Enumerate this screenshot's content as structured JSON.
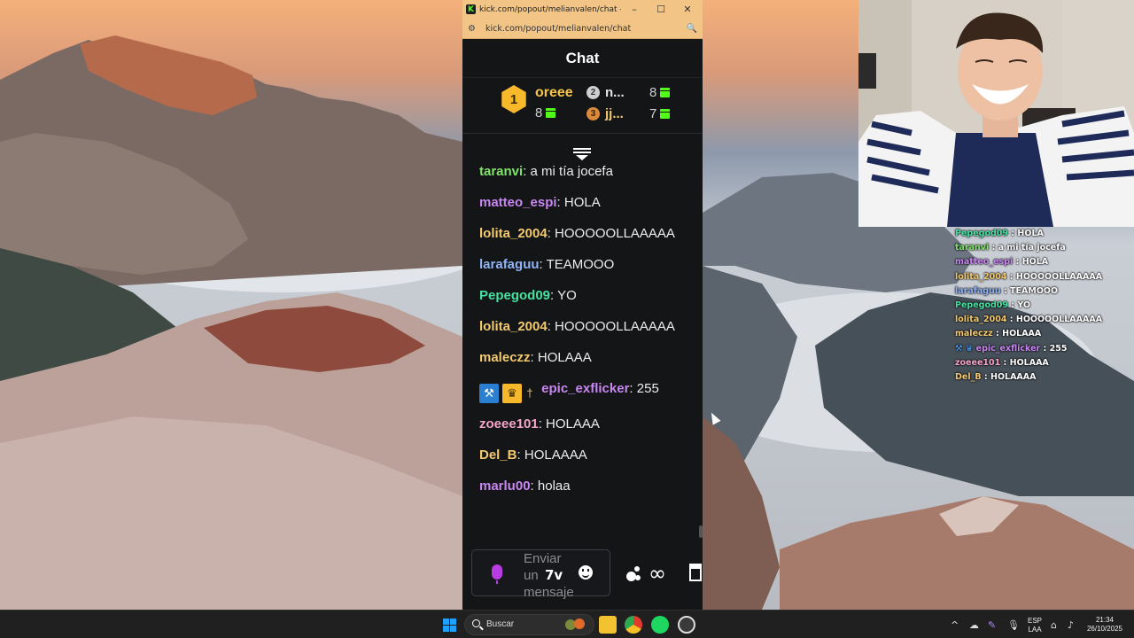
{
  "browser": {
    "title": "kick.com/popout/melianvalen/chat - Googl...",
    "url": "kick.com/popout/melianvalen/chat",
    "favicon": "K",
    "minimize": "–",
    "maximize": "☐",
    "close": "✕",
    "site_icon": "⚙",
    "zoom_icon": "🔍"
  },
  "chat": {
    "header": "Chat",
    "leaderboard": {
      "first": {
        "rank": "1",
        "name": "oreee",
        "count": "8"
      },
      "second": {
        "rank": "2",
        "name": "n...",
        "count": "8"
      },
      "third": {
        "rank": "3",
        "name": "jj...",
        "count": "7"
      }
    },
    "messages": [
      {
        "user": "taranvi",
        "text": " a mi tía jocefa",
        "color": "#7fe26a"
      },
      {
        "user": "matteo_espi",
        "text": " HOLA",
        "color": "#c786f0"
      },
      {
        "user": "lolita_2004",
        "text": " HOOOOOLLAAAAA",
        "color": "#f2c96f"
      },
      {
        "user": "larafaguu",
        "text": " TEAMOOO",
        "color": "#8fb3f5"
      },
      {
        "user": "Pepegod09",
        "text": " YO",
        "color": "#46e0a0"
      },
      {
        "user": "lolita_2004",
        "text": " HOOOOOLLAAAAA",
        "color": "#f2c96f"
      },
      {
        "user": "maleczz",
        "text": " HOLAAA",
        "color": "#f2c96f"
      },
      {
        "user": "epic_exflicker",
        "text": " 255",
        "color": "#c786f0"
      },
      {
        "user": "zoeee101",
        "text": " HOLAAA",
        "color": "#f4a5c8"
      },
      {
        "user": "Del_B",
        "text": " HOLAAAA",
        "color": "#f2c96f"
      },
      {
        "user": "marlu00",
        "text": " holaa",
        "color": "#c786f0"
      }
    ],
    "separator": ":",
    "composer": {
      "placeholder": "Enviar un mensaje",
      "emote": "7v"
    },
    "infinity": "∞"
  },
  "overlay": {
    "lines": [
      {
        "user": "Pepegod09",
        "text": " : HOLA",
        "color": "#46e0a0"
      },
      {
        "user": "taranvi",
        "text": " : a mi tía jocefa",
        "color": "#7fe26a"
      },
      {
        "user": "matteo_espi",
        "text": " : HOLA",
        "color": "#c786f0"
      },
      {
        "user": "lolita_2004",
        "text": " : HOOOOOLLAAAAA",
        "color": "#f2c96f"
      },
      {
        "user": "larafaguu",
        "text": " : TEAMOOO",
        "color": "#8fb3f5"
      },
      {
        "user": "Pepegod09",
        "text": " : YO",
        "color": "#46e0a0"
      },
      {
        "user": "lolita_2004",
        "text": " : HOOOOOLLAAAAA",
        "color": "#f2c96f"
      },
      {
        "user": "maleczz",
        "text": " : HOLAAA",
        "color": "#f2c96f"
      },
      {
        "user": "epic_exflicker",
        "text": " : 255",
        "color": "#c786f0"
      },
      {
        "user": "zoeee101",
        "text": " : HOLAAA",
        "color": "#f4a5c8"
      },
      {
        "user": "Del_B",
        "text": " : HOLAAAA",
        "color": "#f2c96f"
      }
    ]
  },
  "taskbar": {
    "search": "Buscar",
    "lang_top": "ESP",
    "lang_bottom": "LAA",
    "time": "21:34",
    "date": "26/10/2025",
    "chevron": "^"
  }
}
